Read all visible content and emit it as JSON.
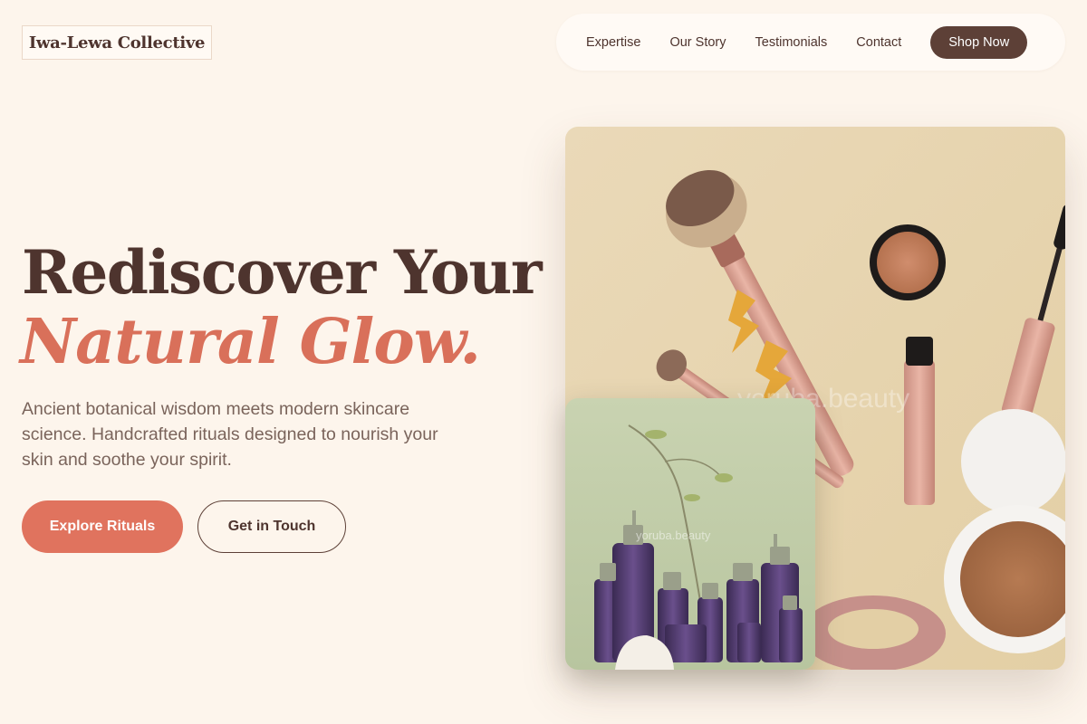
{
  "brand": {
    "name": "Iwa-Lewa Collective"
  },
  "nav": {
    "links": [
      "Expertise",
      "Our Story",
      "Testimonials",
      "Contact"
    ],
    "cta": "Shop Now"
  },
  "hero": {
    "headline": "Rediscover Your",
    "headline_accent": "Natural Glow.",
    "description": "Ancient botanical wisdom meets modern skincare science. Handcrafted rituals designed to nourish your skin and soothe your spirit.",
    "primary_button": "Explore Rituals",
    "secondary_button": "Get in Touch"
  },
  "images": {
    "main_watermark": "yoruba.beauty",
    "overlay_watermark": "yoruba.beauty"
  },
  "colors": {
    "background": "#fdf5ec",
    "brand_brown": "#5d4037",
    "accent_coral": "#e0735e"
  }
}
